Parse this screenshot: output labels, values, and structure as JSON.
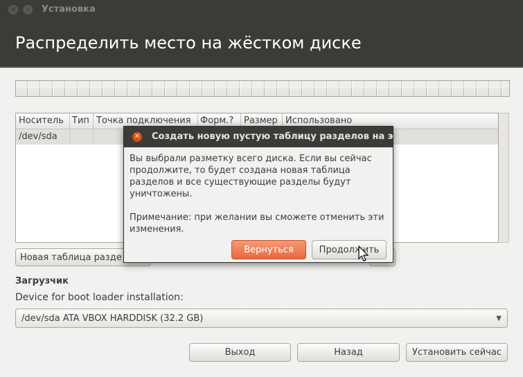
{
  "window": {
    "title": "Установка",
    "close_glyph": "×",
    "minimize_glyph": "–"
  },
  "header": {
    "title": "Распределить место на жёстком диске"
  },
  "table": {
    "columns": [
      "Носитель",
      "Тип",
      "Точка подключения",
      "Форм.?",
      "Размер",
      "Использовано"
    ],
    "rows": [
      {
        "device": "/dev/sda"
      }
    ]
  },
  "partition_buttons": {
    "new_table_label": "Новая таблица разде"
  },
  "bootloader": {
    "heading": "Загрузчик",
    "label": "Device for boot loader installation:",
    "selected": "/dev/sda ATA VBOX HARDDISK (32.2 GB)"
  },
  "footer": {
    "quit": "Выход",
    "back": "Назад",
    "install": "Установить сейчас"
  },
  "dialog": {
    "title": "Создать новую пустую таблицу разделов на этом устройстве?",
    "message": "Вы выбрали разметку всего диска. Если вы сейчас продолжите, то будет создана новая таблица разделов и все существующие разделы будут уничтожены.",
    "note": "Примечание: при желании вы сможете отменить эти изменения.",
    "back_button": "Вернуться",
    "continue_button": "Продолжить"
  },
  "colors": {
    "accent": "#e9683f",
    "titlebar": "#3c3b37"
  }
}
